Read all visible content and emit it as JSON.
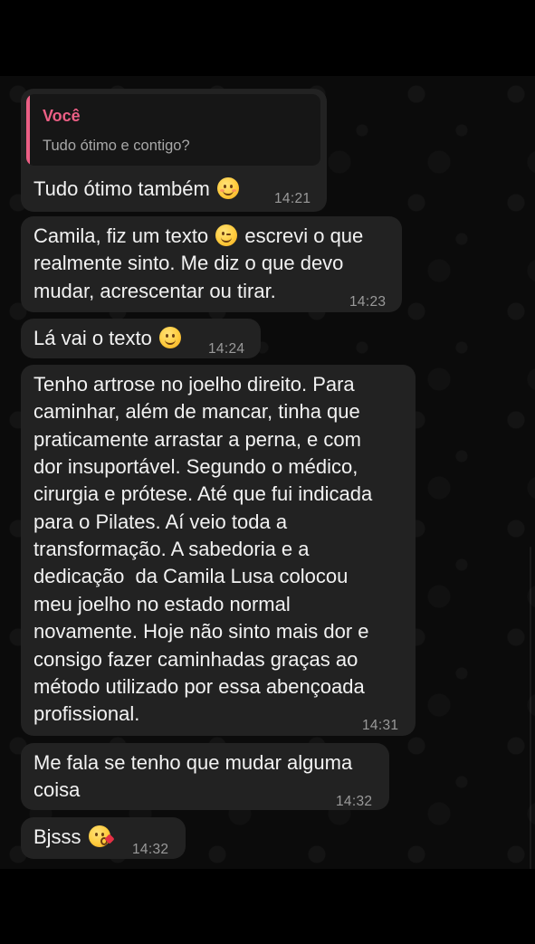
{
  "conversation": {
    "messages": [
      {
        "quoted": {
          "author": "Você",
          "text": "Tudo ótimo e contigo?"
        },
        "text_before": "Tudo ótimo também",
        "emoji": "smiling-face-icon",
        "time": "14:21"
      },
      {
        "line1_before": "Camila, fiz um texto",
        "line1_emoji": "winking-face-icon",
        "line1_after": "escrevi o que",
        "lines": [
          "realmente sinto. Me diz o que devo",
          "mudar, acrescentar ou tirar."
        ],
        "time": "14:23"
      },
      {
        "text_before": "Lá vai o texto",
        "emoji": "smiling-eyes-face-icon",
        "time": "14:24"
      },
      {
        "lines": [
          "Tenho artrose no joelho direito. Para",
          "caminhar, além de mancar, tinha que",
          "praticamente arrastar a perna, e com",
          "dor insuportável. Segundo o médico,",
          "cirurgia e prótese. Até que fui indicada",
          "para o Pilates. Aí veio toda a",
          "transformação. A sabedoria e a",
          "dedicação  da Camila Lusa colocou",
          "meu joelho no estado normal",
          "novamente. Hoje não sinto mais dor e",
          "consigo fazer caminhadas graças ao",
          "método utilizado por essa abençoada",
          "profissional."
        ],
        "time": "14:31"
      },
      {
        "lines": [
          "Me fala se tenho que mudar alguma",
          "coisa"
        ],
        "time": "14:32"
      },
      {
        "text_before": "Bjsss",
        "emoji": "kissing-face-icon",
        "time": "14:32"
      }
    ]
  },
  "colors": {
    "background": "#000000",
    "bubble": "#222222",
    "quote_accent": "#ec5f85",
    "timestamp": "#9a9a9a"
  }
}
